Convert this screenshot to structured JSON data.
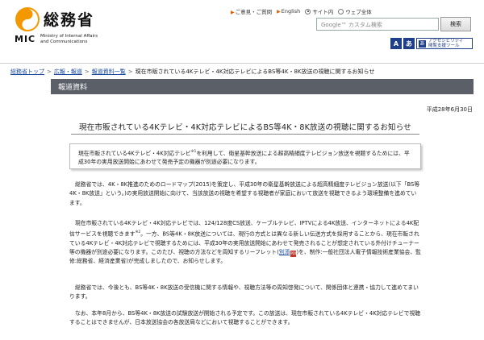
{
  "header": {
    "logo_ja": "総務省",
    "logo_mic": "MIC",
    "logo_en_line1": "Ministry of Internal Affairs",
    "logo_en_line2": "and Communications",
    "links": [
      "ご意見・ご質問",
      "English"
    ],
    "radio_site": "サイト内",
    "radio_web": "ウェブ全体",
    "search_placeholder": "Google™ カスタム検索",
    "search_button": "検索",
    "a11y_tool_line1": "アクセシビリティ",
    "a11y_tool_line2": "閲覧支援ツール",
    "a11y_btn_a": "A",
    "a11y_btn_b": "あ",
    "a11y_tool_icon": "あ",
    "logo_colors": {
      "orange": "#f39800",
      "accent_blue": "#1e3f8a"
    }
  },
  "breadcrumb": {
    "items": [
      "総務省トップ",
      "広報・報道",
      "報道資料一覧"
    ],
    "separator": ">",
    "current": "現在市販されている4Kテレビ・4K対応テレビによるBS等4K・8K放送の視聴に関するお知らせ"
  },
  "section_title": "報道資料",
  "date": "平成28年6月30日",
  "title": "現在市販されている4Kテレビ・4K対応テレビによるBS等4K・8K放送の視聴に関するお知らせ",
  "lead": {
    "part1": "現在市販されている4Kテレビ・4K対応テレビ",
    "sup1": "※1",
    "part2": "を利用して、衛星基幹放送による超高精細度テレビジョン放送を視聴するためには、平成30年の実用放送開始にあわせて発売予定の機器が別途必要になります。"
  },
  "paragraphs": {
    "p1": "総務省では、4K・8K推進のためのロードマップ(2015)を策定し、平成30年の衛星基幹放送による超高精細度テレビジョン放送(以下「BS等4K・8K放送」という。)の実用放送開始に向けて、当該放送の視聴を希望する視聴者が家庭において放送を視聴できるよう環境整備を進めています。",
    "p2_part1": "現在市販されている4Kテレビ・4K対応テレビでは、124/128度CS放送、ケーブルテレビ、IPTVによる4K放送、インターネットによる4K配信サービスを視聴できます",
    "p2_sup": "※2",
    "p2_part2": "。一方、BS等4K・8K放送については、現行の方式とは異なる新しい伝送方式を採用することから、現在市販されている4Kテレビ・4K対応テレビで視聴するためには、平成30年の実用放送開始にあわせて発売されることが想定されている外付けチューナー等の機器が別途必要になります。このたび、視聴の方法などを周知するリーフレット(",
    "p2_link": "別添",
    "p2_pdf": "PDF",
    "p2_part3": ")を、制作:一般社団法人電子情報技術産業協会、監修:総務省、経済産業省)が完成しましたので、お知らせします。",
    "p3": "総務省では、今後とも、BS等4K・8K放送の受信機に関する情報や、視聴方法等の周知啓発について、関係団体と連携・協力して進めてまいります。",
    "p4": "なお、本年8月から、BS等4K・8K放送の試験放送が開始される予定です。この放送は、現在市販されている4Kテレビ・4K対応テレビで視聴することはできませんが、日本放送協会の各放送局などにおいて視聴することができます。"
  }
}
